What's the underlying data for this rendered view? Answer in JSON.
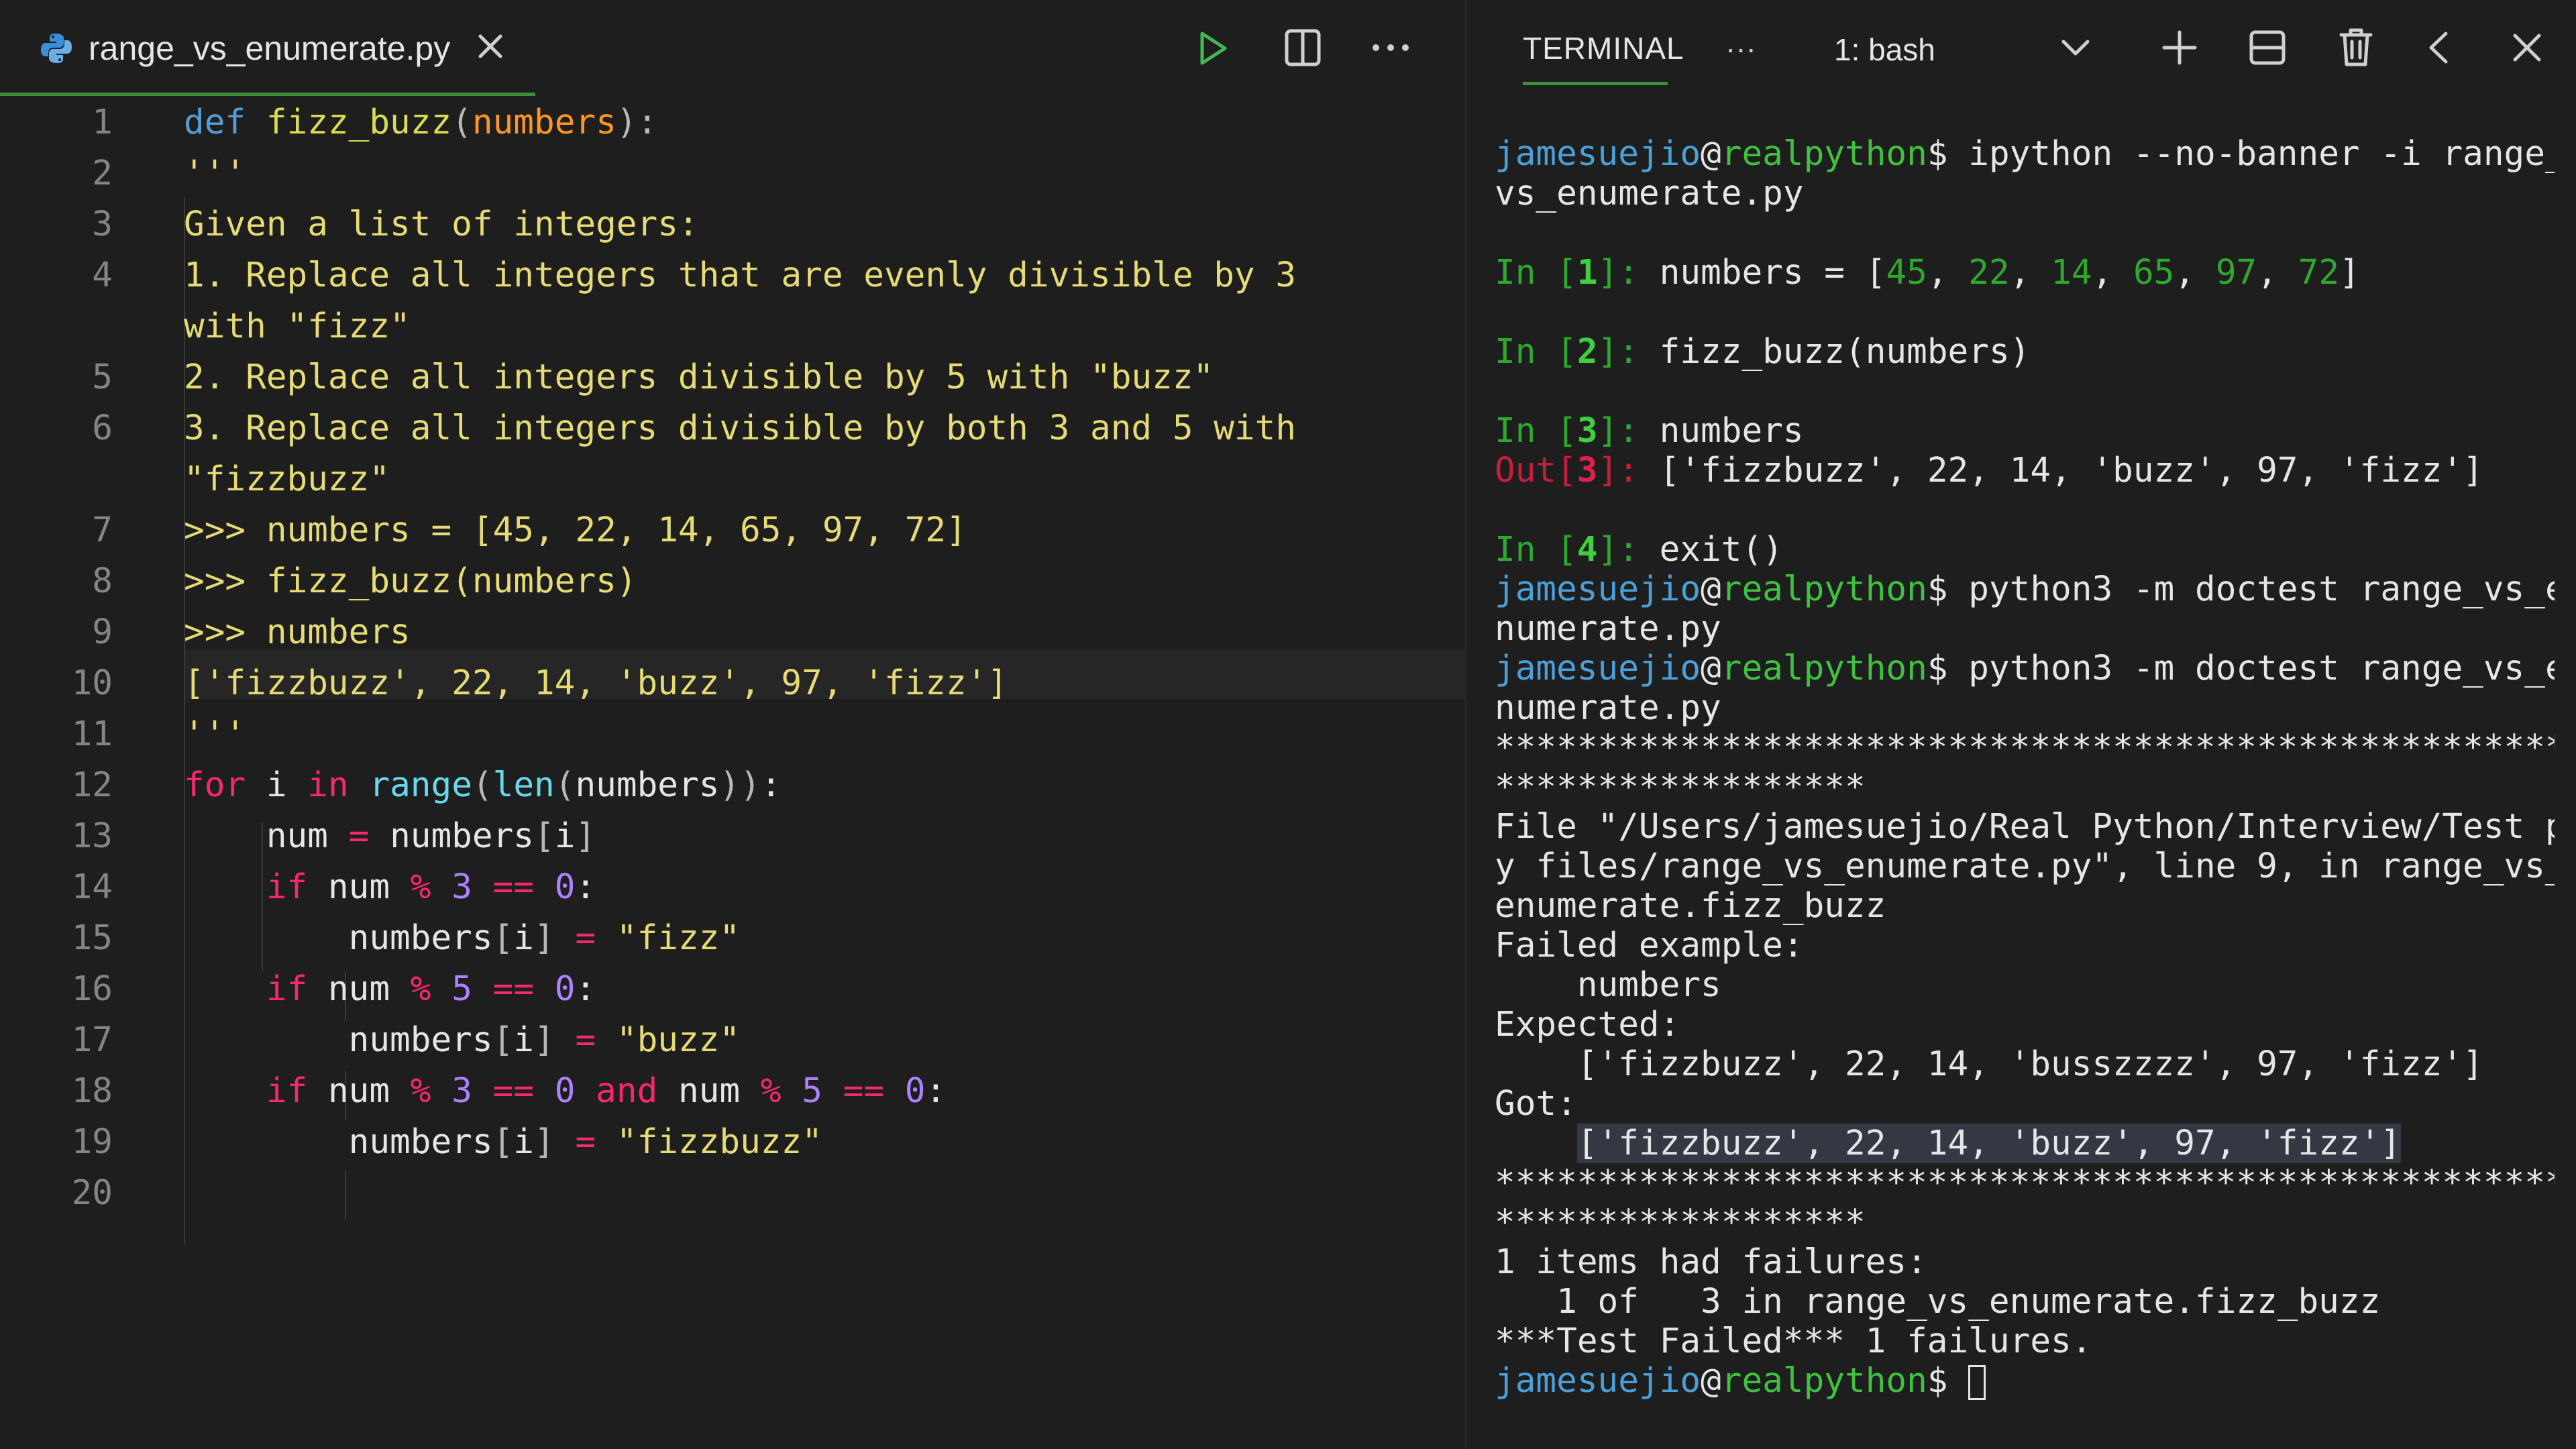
{
  "editor": {
    "tab_title": "range_vs_enumerate.py",
    "code_lines": [
      {
        "n": "1",
        "segs": [
          [
            "ky",
            "def "
          ],
          [
            "fn",
            "fizz_buzz"
          ],
          [
            "pu",
            "("
          ],
          [
            "pa",
            "numbers"
          ],
          [
            "pu",
            "):"
          ]
        ]
      },
      {
        "n": "2",
        "segs": [
          [
            "str",
            "    '''"
          ]
        ]
      },
      {
        "n": "3",
        "segs": [
          [
            "str",
            "    Given a list of integers:"
          ]
        ]
      },
      {
        "n": "4",
        "segs": [
          [
            "str",
            "    1. Replace all integers that are evenly divisible by 3"
          ]
        ]
      },
      {
        "n": "",
        "segs": [
          [
            "str",
            "    with \"fizz\""
          ]
        ]
      },
      {
        "n": "5",
        "segs": [
          [
            "str",
            "    2. Replace all integers divisible by 5 with \"buzz\""
          ]
        ]
      },
      {
        "n": "6",
        "segs": [
          [
            "str",
            "    3. Replace all integers divisible by both 3 and 5 with"
          ]
        ]
      },
      {
        "n": "",
        "segs": [
          [
            "str",
            "    \"fizzbuzz\""
          ]
        ]
      },
      {
        "n": "7",
        "segs": [
          [
            "str",
            "    >>> numbers = [45, 22, 14, 65, 97, 72]"
          ]
        ]
      },
      {
        "n": "8",
        "segs": [
          [
            "str",
            "    >>> fizz_buzz(numbers)"
          ]
        ]
      },
      {
        "n": "9",
        "segs": [
          [
            "str",
            "    >>> numbers"
          ]
        ]
      },
      {
        "n": "10",
        "segs": [
          [
            "str",
            "    ['fizzbuzz', 22, 14, 'buzz', 97, 'fizz']"
          ]
        ]
      },
      {
        "n": "11",
        "segs": [
          [
            "str",
            "    '''"
          ]
        ]
      },
      {
        "n": "12",
        "segs": [
          [
            "kw",
            "    for "
          ],
          [
            "pl",
            "i "
          ],
          [
            "kw",
            "in "
          ],
          [
            "bi",
            "range"
          ],
          [
            "pu",
            "("
          ],
          [
            "bi",
            "len"
          ],
          [
            "pu",
            "("
          ],
          [
            "pl",
            "numbers"
          ],
          [
            "pu",
            "))"
          ],
          [
            "pl",
            ":"
          ]
        ]
      },
      {
        "n": "13",
        "segs": [
          [
            "pl",
            "        num "
          ],
          [
            "kw",
            "= "
          ],
          [
            "pl",
            "numbers"
          ],
          [
            "pu",
            "["
          ],
          [
            "pl",
            "i"
          ],
          [
            "pu",
            "]"
          ]
        ]
      },
      {
        "n": "14",
        "segs": [
          [
            "kw",
            "        if "
          ],
          [
            "pl",
            "num "
          ],
          [
            "kw",
            "% "
          ],
          [
            "nu",
            "3 "
          ],
          [
            "kw",
            "== "
          ],
          [
            "nu",
            "0"
          ],
          [
            "pl",
            ":"
          ]
        ]
      },
      {
        "n": "15",
        "segs": [
          [
            "pl",
            "            numbers"
          ],
          [
            "pu",
            "["
          ],
          [
            "pl",
            "i"
          ],
          [
            "pu",
            "] "
          ],
          [
            "kw",
            "= "
          ],
          [
            "str",
            "\"fizz\""
          ]
        ]
      },
      {
        "n": "16",
        "segs": [
          [
            "kw",
            "        if "
          ],
          [
            "pl",
            "num "
          ],
          [
            "kw",
            "% "
          ],
          [
            "nu",
            "5 "
          ],
          [
            "kw",
            "== "
          ],
          [
            "nu",
            "0"
          ],
          [
            "pl",
            ":"
          ]
        ]
      },
      {
        "n": "17",
        "segs": [
          [
            "pl",
            "            numbers"
          ],
          [
            "pu",
            "["
          ],
          [
            "pl",
            "i"
          ],
          [
            "pu",
            "] "
          ],
          [
            "kw",
            "= "
          ],
          [
            "str",
            "\"buzz\""
          ]
        ]
      },
      {
        "n": "18",
        "segs": [
          [
            "kw",
            "        if "
          ],
          [
            "pl",
            "num "
          ],
          [
            "kw",
            "% "
          ],
          [
            "nu",
            "3 "
          ],
          [
            "kw",
            "== "
          ],
          [
            "nu",
            "0 "
          ],
          [
            "kw",
            "and "
          ],
          [
            "pl",
            "num "
          ],
          [
            "kw",
            "% "
          ],
          [
            "nu",
            "5 "
          ],
          [
            "kw",
            "== "
          ],
          [
            "nu",
            "0"
          ],
          [
            "pl",
            ":"
          ]
        ]
      },
      {
        "n": "19",
        "segs": [
          [
            "pl",
            "            numbers"
          ],
          [
            "pu",
            "["
          ],
          [
            "pl",
            "i"
          ],
          [
            "pu",
            "] "
          ],
          [
            "kw",
            "= "
          ],
          [
            "str",
            "\"fizzbuzz\""
          ]
        ]
      },
      {
        "n": "20",
        "segs": [
          [
            "pl",
            ""
          ]
        ]
      }
    ]
  },
  "terminal": {
    "tab_label": "TERMINAL",
    "more_label": "···",
    "shell_select": "1: bash",
    "user": "jamesuejio",
    "at": "@",
    "host": "realpython",
    "prompt_sign": "$ ",
    "cmd_ipython_a": "ipython --no-banner -i range_",
    "cmd_ipython_b": "vs_enumerate.py",
    "in_label": "In [",
    "out_label": "Out[",
    "bracket_close": "]: ",
    "in1": "1",
    "in1_pre": "numbers = [",
    "in1_nums": [
      "45",
      "22",
      "14",
      "65",
      "97",
      "72"
    ],
    "in1_sep": ", ",
    "in1_post": "]",
    "in2": "2",
    "in2_cmd": "fizz_buzz(numbers)",
    "in3": "3",
    "in3_cmd": "numbers",
    "out3": "3",
    "out3_val": "['fizzbuzz', 22, 14, 'buzz', 97, 'fizz']",
    "in4": "4",
    "in4_cmd": "exit()",
    "cmd_doctest_a": "python3 -m doctest range_vs_e",
    "cmd_doctest_b": "numerate.py",
    "stars_a": "*********************************************************",
    "stars_b": "******************",
    "file_a": "File \"/Users/jamesuejio/Real Python/Interview/Test p",
    "file_b": "y files/range_vs_enumerate.py\", line 9, in range_vs_",
    "file_c": "enumerate.fizz_buzz",
    "failed_example": "Failed example:",
    "failed_expr": "    numbers",
    "expected": "Expected:",
    "expected_val": "    ['fizzbuzz', 22, 14, 'busszzzz', 97, 'fizz']",
    "got": "Got:",
    "got_indent": "    ",
    "got_val": "['fizzbuzz', 22, 14, 'buzz', 97, 'fizz']",
    "summary1": "1 items had failures:",
    "summary2": "   1 of   3 in range_vs_enumerate.fizz_buzz",
    "summary3": "***Test Failed*** 1 failures."
  },
  "colors": {
    "accent_underline": "#3c8f3c",
    "run_icon": "#3fb950",
    "python_icon": "#3b8fd9"
  },
  "icons": [
    "python-file-icon",
    "close-icon",
    "run-icon",
    "split-editor-icon",
    "more-icon",
    "chevron-down-icon",
    "plus-icon",
    "split-terminal-icon",
    "trash-icon",
    "chevron-left-icon",
    "close-panel-icon"
  ]
}
